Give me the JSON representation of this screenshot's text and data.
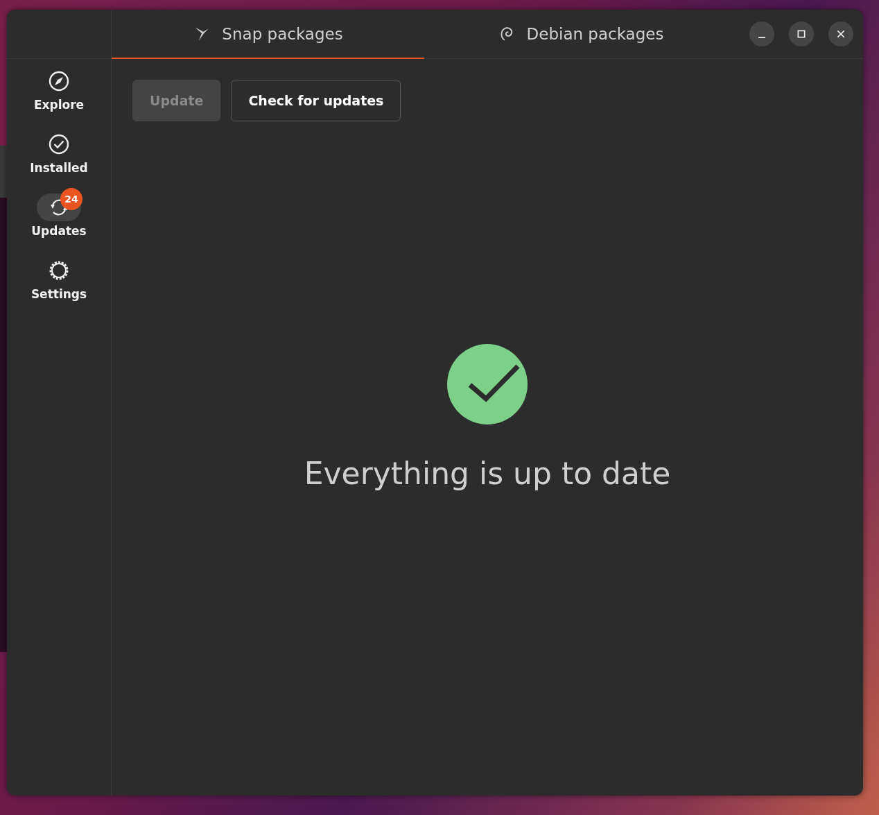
{
  "tabs": [
    {
      "label": "Snap packages",
      "kind": "snap",
      "selected": true
    },
    {
      "label": "Debian packages",
      "kind": "debian",
      "selected": false
    }
  ],
  "sidebar": {
    "items": [
      {
        "label": "Explore",
        "kind": "explore",
        "selected": false
      },
      {
        "label": "Installed",
        "kind": "installed",
        "selected": false
      },
      {
        "label": "Updates",
        "kind": "updates",
        "selected": true,
        "badge": "24"
      },
      {
        "label": "Settings",
        "kind": "settings",
        "selected": false
      }
    ]
  },
  "toolbar": {
    "buttons": [
      {
        "label": "Update",
        "disabled": true
      },
      {
        "label": "Check for updates",
        "disabled": false
      }
    ]
  },
  "status": {
    "message": "Everything is up to date"
  }
}
